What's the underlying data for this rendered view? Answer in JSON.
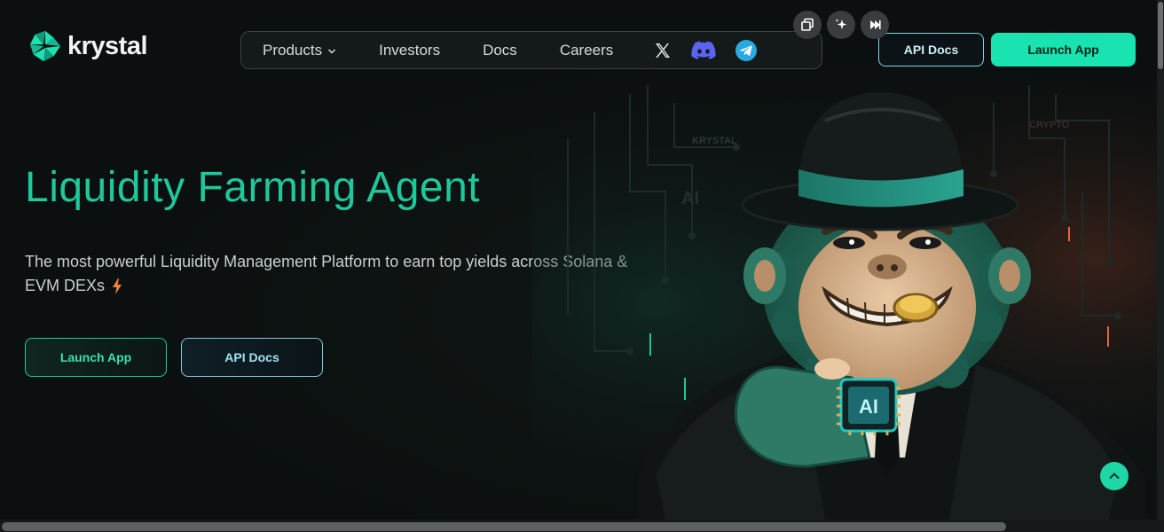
{
  "brand": {
    "name": "krystal",
    "accent": "#19e3b0"
  },
  "floating_tools": [
    {
      "icon": "copy-window-icon"
    },
    {
      "icon": "sparkle-icon"
    },
    {
      "icon": "skip-forward-icon"
    }
  ],
  "nav": {
    "items": [
      {
        "label": "Products",
        "has_dropdown": true
      },
      {
        "label": "Investors"
      },
      {
        "label": "Docs"
      },
      {
        "label": "Careers"
      }
    ],
    "social": [
      {
        "icon": "x-twitter-icon"
      },
      {
        "icon": "discord-icon"
      },
      {
        "icon": "telegram-icon"
      }
    ]
  },
  "header_buttons": {
    "api_docs": "API Docs",
    "launch_app": "Launch App"
  },
  "hero": {
    "title": "Liquidity Farming Agent",
    "subtitle": "The most powerful Liquidity Management Platform to earn top yields across Solana & EVM DEXs",
    "launch_app": "Launch App",
    "api_docs": "API Docs"
  },
  "illustration": {
    "labels": {
      "krystal": "KRYSTAL",
      "crypto": "CRYPTO",
      "ai": "AI",
      "chip": "AI"
    }
  }
}
